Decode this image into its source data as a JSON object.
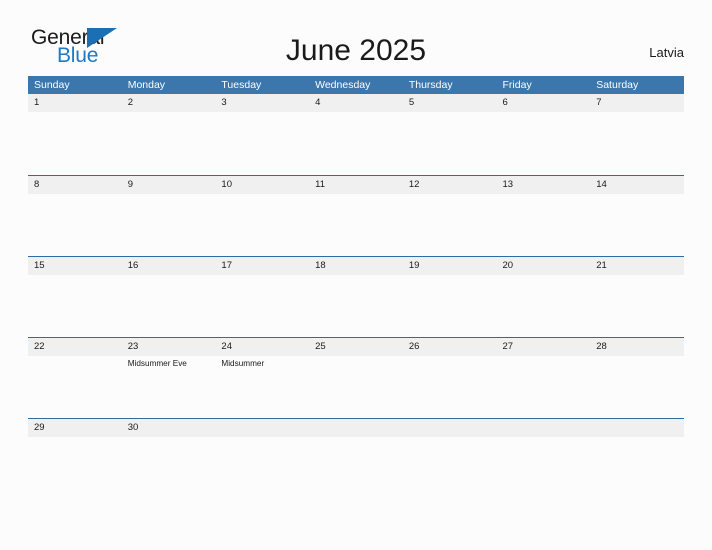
{
  "brand": {
    "word_one": "General",
    "word_two": "Blue",
    "triangle_icon": "triangle-icon",
    "color_dark": "#1a1a1a",
    "color_blue": "#1f7ac4",
    "color_triangle": "#1b6fb3"
  },
  "header": {
    "title": "June 2025",
    "country": "Latvia"
  },
  "colors": {
    "header_blue": "#3b76ad",
    "rule_blue": "#2e6da4",
    "band_gray": "#f0f0f0",
    "page_background": "#fcfcfd",
    "text": "#1a1a1a"
  },
  "calendar": {
    "weekdays": [
      "Sunday",
      "Monday",
      "Tuesday",
      "Wednesday",
      "Thursday",
      "Friday",
      "Saturday"
    ],
    "weeks": [
      [
        {
          "day": "1",
          "events": []
        },
        {
          "day": "2",
          "events": []
        },
        {
          "day": "3",
          "events": []
        },
        {
          "day": "4",
          "events": []
        },
        {
          "day": "5",
          "events": []
        },
        {
          "day": "6",
          "events": []
        },
        {
          "day": "7",
          "events": []
        }
      ],
      [
        {
          "day": "8",
          "events": []
        },
        {
          "day": "9",
          "events": []
        },
        {
          "day": "10",
          "events": []
        },
        {
          "day": "11",
          "events": []
        },
        {
          "day": "12",
          "events": []
        },
        {
          "day": "13",
          "events": []
        },
        {
          "day": "14",
          "events": []
        }
      ],
      [
        {
          "day": "15",
          "events": []
        },
        {
          "day": "16",
          "events": []
        },
        {
          "day": "17",
          "events": []
        },
        {
          "day": "18",
          "events": []
        },
        {
          "day": "19",
          "events": []
        },
        {
          "day": "20",
          "events": []
        },
        {
          "day": "21",
          "events": []
        }
      ],
      [
        {
          "day": "22",
          "events": []
        },
        {
          "day": "23",
          "events": [
            "Midsummer Eve"
          ]
        },
        {
          "day": "24",
          "events": [
            "Midsummer"
          ]
        },
        {
          "day": "25",
          "events": []
        },
        {
          "day": "26",
          "events": []
        },
        {
          "day": "27",
          "events": []
        },
        {
          "day": "28",
          "events": []
        }
      ],
      [
        {
          "day": "29",
          "events": []
        },
        {
          "day": "30",
          "events": []
        },
        {
          "day": "",
          "events": []
        },
        {
          "day": "",
          "events": []
        },
        {
          "day": "",
          "events": []
        },
        {
          "day": "",
          "events": []
        },
        {
          "day": "",
          "events": []
        }
      ]
    ]
  }
}
